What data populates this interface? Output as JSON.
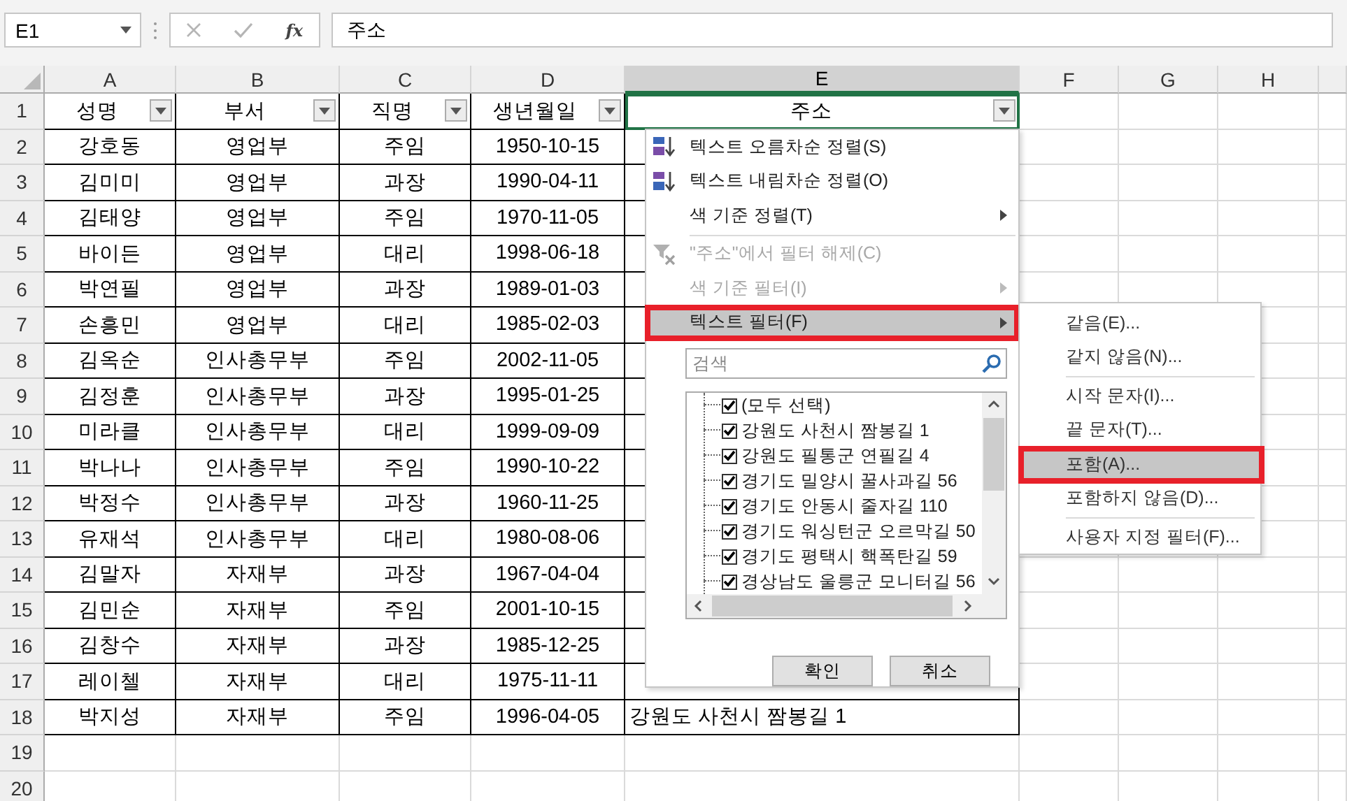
{
  "name_box": "E1",
  "formula_bar": {
    "fx_label": "fx",
    "value": "주소"
  },
  "columns": [
    {
      "label": "A",
      "selected": false
    },
    {
      "label": "B",
      "selected": false
    },
    {
      "label": "C",
      "selected": false
    },
    {
      "label": "D",
      "selected": false
    },
    {
      "label": "E",
      "selected": true
    },
    {
      "label": "F",
      "selected": false
    },
    {
      "label": "G",
      "selected": false
    },
    {
      "label": "H",
      "selected": false
    }
  ],
  "rows": [
    {
      "number": "1",
      "cells": [
        {
          "text": "성명",
          "filter": true
        },
        {
          "text": "부서",
          "filter": true
        },
        {
          "text": "직명",
          "filter": true
        },
        {
          "text": "생년월일",
          "filter": true
        },
        {
          "text": "주소",
          "filter": true,
          "selected": true
        }
      ]
    },
    {
      "number": "2",
      "cells": [
        {
          "text": "강호동"
        },
        {
          "text": "영업부"
        },
        {
          "text": "주임"
        },
        {
          "text": "1950-10-15"
        }
      ]
    },
    {
      "number": "3",
      "cells": [
        {
          "text": "김미미"
        },
        {
          "text": "영업부"
        },
        {
          "text": "과장"
        },
        {
          "text": "1990-04-11"
        }
      ]
    },
    {
      "number": "4",
      "cells": [
        {
          "text": "김태양"
        },
        {
          "text": "영업부"
        },
        {
          "text": "주임"
        },
        {
          "text": "1970-11-05"
        }
      ]
    },
    {
      "number": "5",
      "cells": [
        {
          "text": "바이든"
        },
        {
          "text": "영업부"
        },
        {
          "text": "대리"
        },
        {
          "text": "1998-06-18"
        }
      ]
    },
    {
      "number": "6",
      "cells": [
        {
          "text": "박연필"
        },
        {
          "text": "영업부"
        },
        {
          "text": "과장"
        },
        {
          "text": "1989-01-03"
        }
      ]
    },
    {
      "number": "7",
      "cells": [
        {
          "text": "손흥민"
        },
        {
          "text": "영업부"
        },
        {
          "text": "대리"
        },
        {
          "text": "1985-02-03"
        }
      ]
    },
    {
      "number": "8",
      "cells": [
        {
          "text": "김옥순"
        },
        {
          "text": "인사총무부"
        },
        {
          "text": "주임"
        },
        {
          "text": "2002-11-05"
        }
      ]
    },
    {
      "number": "9",
      "cells": [
        {
          "text": "김정훈"
        },
        {
          "text": "인사총무부"
        },
        {
          "text": "과장"
        },
        {
          "text": "1995-01-25"
        }
      ]
    },
    {
      "number": "10",
      "cells": [
        {
          "text": "미라클"
        },
        {
          "text": "인사총무부"
        },
        {
          "text": "대리"
        },
        {
          "text": "1999-09-09"
        }
      ]
    },
    {
      "number": "11",
      "cells": [
        {
          "text": "박나나"
        },
        {
          "text": "인사총무부"
        },
        {
          "text": "주임"
        },
        {
          "text": "1990-10-22"
        }
      ]
    },
    {
      "number": "12",
      "cells": [
        {
          "text": "박정수"
        },
        {
          "text": "인사총무부"
        },
        {
          "text": "과장"
        },
        {
          "text": "1960-11-25"
        }
      ]
    },
    {
      "number": "13",
      "cells": [
        {
          "text": "유재석"
        },
        {
          "text": "인사총무부"
        },
        {
          "text": "대리"
        },
        {
          "text": "1980-08-06"
        }
      ]
    },
    {
      "number": "14",
      "cells": [
        {
          "text": "김말자"
        },
        {
          "text": "자재부"
        },
        {
          "text": "과장"
        },
        {
          "text": "1967-04-04"
        }
      ]
    },
    {
      "number": "15",
      "cells": [
        {
          "text": "김민순"
        },
        {
          "text": "자재부"
        },
        {
          "text": "주임"
        },
        {
          "text": "2001-10-15"
        }
      ]
    },
    {
      "number": "16",
      "cells": [
        {
          "text": "김창수"
        },
        {
          "text": "자재부"
        },
        {
          "text": "과장"
        },
        {
          "text": "1985-12-25"
        }
      ]
    },
    {
      "number": "17",
      "cells": [
        {
          "text": "레이첼"
        },
        {
          "text": "자재부"
        },
        {
          "text": "대리"
        },
        {
          "text": "1975-11-11"
        }
      ]
    },
    {
      "number": "18",
      "cells": [
        {
          "text": "박지성"
        },
        {
          "text": "자재부"
        },
        {
          "text": "주임"
        },
        {
          "text": "1996-04-05"
        },
        {
          "text": "강원도 사천시 짬봉길 1"
        }
      ]
    },
    {
      "number": "19"
    },
    {
      "number": "20"
    }
  ],
  "filter_menu": {
    "items": [
      {
        "kind": "sort_asc",
        "label": "텍스트 오름차순 정렬(S)",
        "disabled": false,
        "submenu": false,
        "highlighted": false
      },
      {
        "kind": "sort_desc",
        "label": "텍스트 내림차순 정렬(O)",
        "disabled": false,
        "submenu": false,
        "highlighted": false
      },
      {
        "kind": "plain",
        "label": "색 기준 정렬(T)",
        "disabled": false,
        "submenu": true,
        "highlighted": false
      },
      {
        "kind": "separator"
      },
      {
        "kind": "clear_filter",
        "label": "\"주소\"에서 필터 해제(C)",
        "disabled": true,
        "submenu": false,
        "highlighted": false
      },
      {
        "kind": "plain",
        "label": "색 기준 필터(I)",
        "disabled": true,
        "submenu": true,
        "highlighted": false
      },
      {
        "kind": "plain",
        "label": "텍스트 필터(F)",
        "disabled": false,
        "submenu": true,
        "highlighted": true
      }
    ],
    "search": {
      "placeholder": "검색"
    },
    "checklist": [
      {
        "label": "(모두 선택)",
        "checked": true
      },
      {
        "label": "강원도 사천시 짬봉길 1",
        "checked": true
      },
      {
        "label": "강원도 필통군 연필길 4",
        "checked": true
      },
      {
        "label": "경기도 밀양시 꿀사과길 56",
        "checked": true
      },
      {
        "label": "경기도 안동시 줄자길 110",
        "checked": true
      },
      {
        "label": "경기도 워싱턴군 오르막길 50",
        "checked": true
      },
      {
        "label": "경기도 평택시 핵폭탄길 59",
        "checked": true
      },
      {
        "label": "경상남도 울릉군 모니터길 56",
        "checked": true
      }
    ],
    "buttons": [
      "확인",
      "취소"
    ]
  },
  "text_filter_menu": [
    {
      "kind": "item",
      "label": "같음(E)...",
      "highlighted": false
    },
    {
      "kind": "item",
      "label": "같지 않음(N)...",
      "highlighted": false
    },
    {
      "kind": "separator"
    },
    {
      "kind": "item",
      "label": "시작 문자(I)...",
      "highlighted": false
    },
    {
      "kind": "item",
      "label": "끝 문자(T)...",
      "highlighted": false
    },
    {
      "kind": "item",
      "label": "포함(A)...",
      "highlighted": true
    },
    {
      "kind": "item",
      "label": "포함하지 않음(D)...",
      "highlighted": false
    },
    {
      "kind": "separator"
    },
    {
      "kind": "item",
      "label": "사용자 지정 필터(F)...",
      "highlighted": false
    }
  ]
}
